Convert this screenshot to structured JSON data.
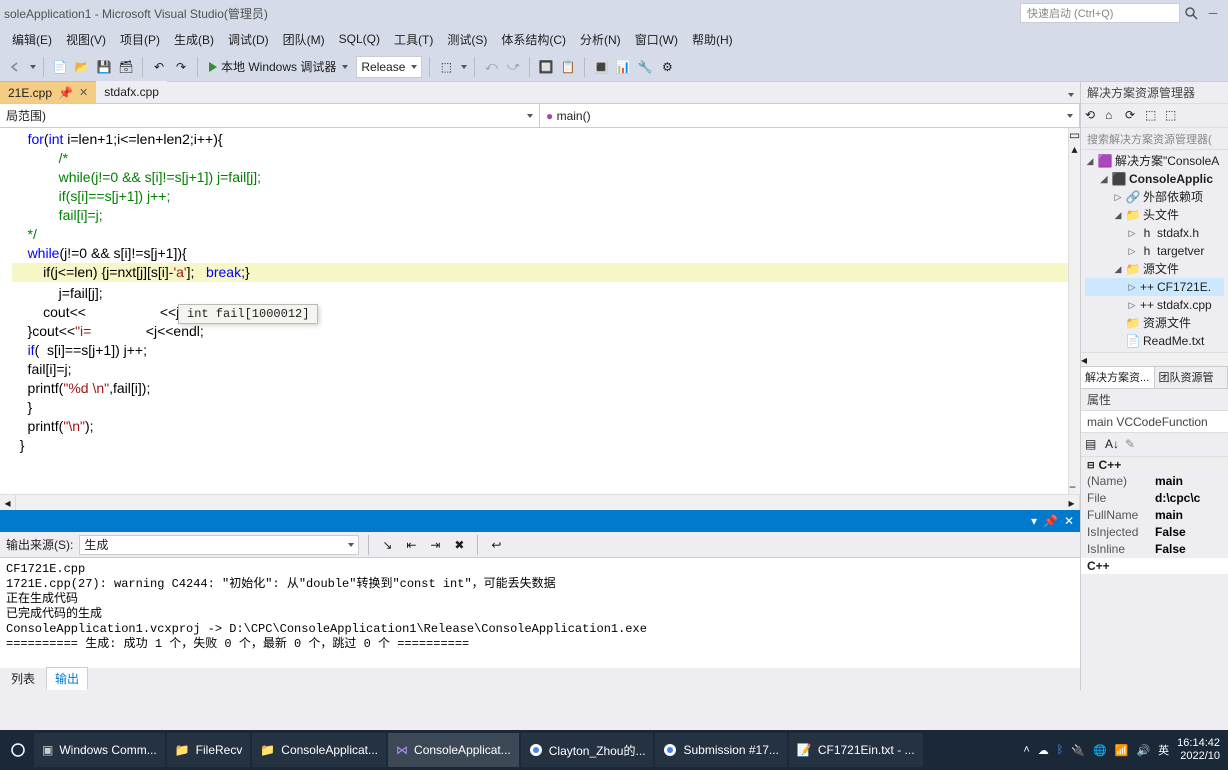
{
  "titlebar": {
    "title": "soleApplication1 - Microsoft Visual Studio(管理员)",
    "quick_launch": "快速启动 (Ctrl+Q)"
  },
  "menu": [
    "编辑(E)",
    "视图(V)",
    "项目(P)",
    "生成(B)",
    "调试(D)",
    "团队(M)",
    "SQL(Q)",
    "工具(T)",
    "测试(S)",
    "体系结构(C)",
    "分析(N)",
    "窗口(W)",
    "帮助(H)"
  ],
  "toolbar": {
    "debug_target": "本地 Windows 调试器",
    "config": "Release"
  },
  "tabs": [
    {
      "label": "21E.cpp",
      "active": true,
      "pinned": true
    },
    {
      "label": "stdafx.cpp",
      "active": false
    }
  ],
  "nav": {
    "left": "局范围)",
    "right": "main()",
    "right_icon": "●"
  },
  "code_lines": [
    {
      "text": "for(int i=len+1;i<=len+len2;i++){"
    },
    {
      "text": "    /*",
      "cls": "cm"
    },
    {
      "text": "    while(j!=0 && s[i]!=s[j+1]) j=fail[j];",
      "cls": "cm"
    },
    {
      "text": "    if(s[i]==s[j+1]) j++;",
      "cls": "cm"
    },
    {
      "text": "    fail[i]=j;",
      "cls": "cm"
    },
    {
      "text": "*/",
      "cls": "cm"
    },
    {
      "text": ""
    },
    {
      "text": "while(j!=0 && s[i]!=s[j+1]){"
    },
    {
      "text": "    if(j<=len) {j=nxt[j][s[i]-'a'];   break;}",
      "hl": true
    },
    {
      "text": "    j=fail[j];"
    },
    {
      "raw": "    cout<<                   <<j<<endl;"
    },
    {
      "raw": "}cout<<\"i=              <j<<endl;"
    },
    {
      "text": "if(  s[i]==s[j+1]) j++;"
    },
    {
      "text": "fail[i]=j;"
    },
    {
      "raw": "printf(\"%d \\n\",fail[i]);"
    },
    {
      "text": "}"
    },
    {
      "raw": "printf(\"\\n\");"
    },
    {
      "text": "}"
    }
  ],
  "tooltip": "int fail[1000012]",
  "output": {
    "label": "输出来源(S):",
    "source": "生成",
    "lines": [
      "CF1721E.cpp",
      "1721E.cpp(27): warning C4244: \"初始化\": 从\"double\"转换到\"const int\"，可能丢失数据",
      "正在生成代码",
      "已完成代码的生成",
      "ConsoleApplication1.vcxproj -> D:\\CPC\\ConsoleApplication1\\Release\\ConsoleApplication1.exe",
      "========== 生成: 成功 1 个，失败 0 个，最新 0 个，跳过 0 个 =========="
    ]
  },
  "bottom_tabs": [
    "列表",
    "输出"
  ],
  "solution_explorer": {
    "title": "解决方案资源管理器",
    "search": "搜索解决方案资源管理器(",
    "tree": [
      {
        "lvl": 0,
        "exp": "open",
        "icon": "sln",
        "label": "解决方案\"ConsoleA"
      },
      {
        "lvl": 1,
        "exp": "open",
        "icon": "proj",
        "label": "ConsoleApplic",
        "bold": true
      },
      {
        "lvl": 2,
        "exp": "closed",
        "icon": "ref",
        "label": "外部依赖项"
      },
      {
        "lvl": 2,
        "exp": "open",
        "icon": "fold",
        "label": "头文件"
      },
      {
        "lvl": 3,
        "exp": "closed",
        "icon": "h",
        "label": "stdafx.h"
      },
      {
        "lvl": 3,
        "exp": "closed",
        "icon": "h",
        "label": "targetver"
      },
      {
        "lvl": 2,
        "exp": "open",
        "icon": "fold",
        "label": "源文件"
      },
      {
        "lvl": 3,
        "exp": "closed",
        "icon": "cpp",
        "label": "CF1721E.",
        "sel": true
      },
      {
        "lvl": 3,
        "exp": "closed",
        "icon": "cpp",
        "label": "stdafx.cpp"
      },
      {
        "lvl": 2,
        "exp": "none",
        "icon": "fold",
        "label": "资源文件"
      },
      {
        "lvl": 2,
        "exp": "none",
        "icon": "txt",
        "label": "ReadMe.txt"
      }
    ]
  },
  "soln_tabs": [
    "解决方案资...",
    "团队资源管"
  ],
  "properties": {
    "title": "属性",
    "subject": "main VCCodeFunction",
    "cat": "C++",
    "rows": [
      {
        "k": "(Name)",
        "v": "main"
      },
      {
        "k": "File",
        "v": "d:\\cpc\\c"
      },
      {
        "k": "FullName",
        "v": "main"
      },
      {
        "k": "IsInjected",
        "v": "False"
      },
      {
        "k": "IsInline",
        "v": "False"
      }
    ],
    "cat2": "C++"
  },
  "taskbar": {
    "items": [
      {
        "label": "Windows Comm...",
        "icon": "term"
      },
      {
        "label": "FileRecv",
        "icon": "folder"
      },
      {
        "label": "ConsoleApplicat...",
        "icon": "folder"
      },
      {
        "label": "ConsoleApplicat...",
        "icon": "vs",
        "active": true
      },
      {
        "label": "Clayton_Zhou的...",
        "icon": "chrome"
      },
      {
        "label": "Submission #17...",
        "icon": "chrome"
      },
      {
        "label": "CF1721Ein.txt - ...",
        "icon": "note"
      }
    ],
    "time": "16:14:42",
    "date": "2022/10"
  }
}
